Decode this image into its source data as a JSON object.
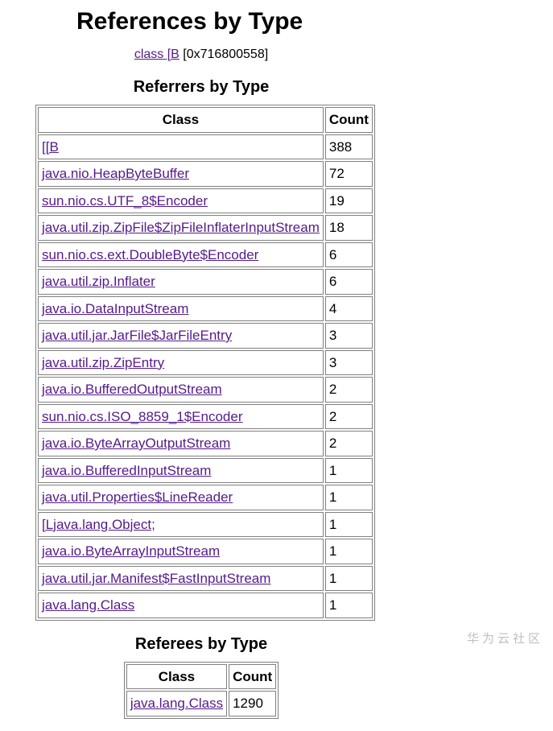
{
  "title": "References by Type",
  "subject": {
    "link_text": "class [B",
    "suffix": " [0x716800558]"
  },
  "referrers": {
    "heading": "Referrers by Type",
    "columns": {
      "class": "Class",
      "count": "Count"
    },
    "rows": [
      {
        "class": "[[B",
        "count": "388"
      },
      {
        "class": "java.nio.HeapByteBuffer",
        "count": "72"
      },
      {
        "class": "sun.nio.cs.UTF_8$Encoder",
        "count": "19"
      },
      {
        "class": "java.util.zip.ZipFile$ZipFileInflaterInputStream",
        "count": "18"
      },
      {
        "class": "sun.nio.cs.ext.DoubleByte$Encoder",
        "count": "6"
      },
      {
        "class": "java.util.zip.Inflater",
        "count": "6"
      },
      {
        "class": "java.io.DataInputStream",
        "count": "4"
      },
      {
        "class": "java.util.jar.JarFile$JarFileEntry",
        "count": "3"
      },
      {
        "class": "java.util.zip.ZipEntry",
        "count": "3"
      },
      {
        "class": "java.io.BufferedOutputStream",
        "count": "2"
      },
      {
        "class": "sun.nio.cs.ISO_8859_1$Encoder",
        "count": "2"
      },
      {
        "class": "java.io.ByteArrayOutputStream",
        "count": "2"
      },
      {
        "class": "java.io.BufferedInputStream",
        "count": "1"
      },
      {
        "class": "java.util.Properties$LineReader",
        "count": "1"
      },
      {
        "class": "[Ljava.lang.Object;",
        "count": "1"
      },
      {
        "class": "java.io.ByteArrayInputStream",
        "count": "1"
      },
      {
        "class": "java.util.jar.Manifest$FastInputStream",
        "count": "1"
      },
      {
        "class": "java.lang.Class",
        "count": "1"
      }
    ]
  },
  "referees": {
    "heading": "Referees by Type",
    "columns": {
      "class": "Class",
      "count": "Count"
    },
    "rows": [
      {
        "class": "java.lang.Class",
        "count": "1290"
      }
    ]
  },
  "watermark": "华为云社区"
}
